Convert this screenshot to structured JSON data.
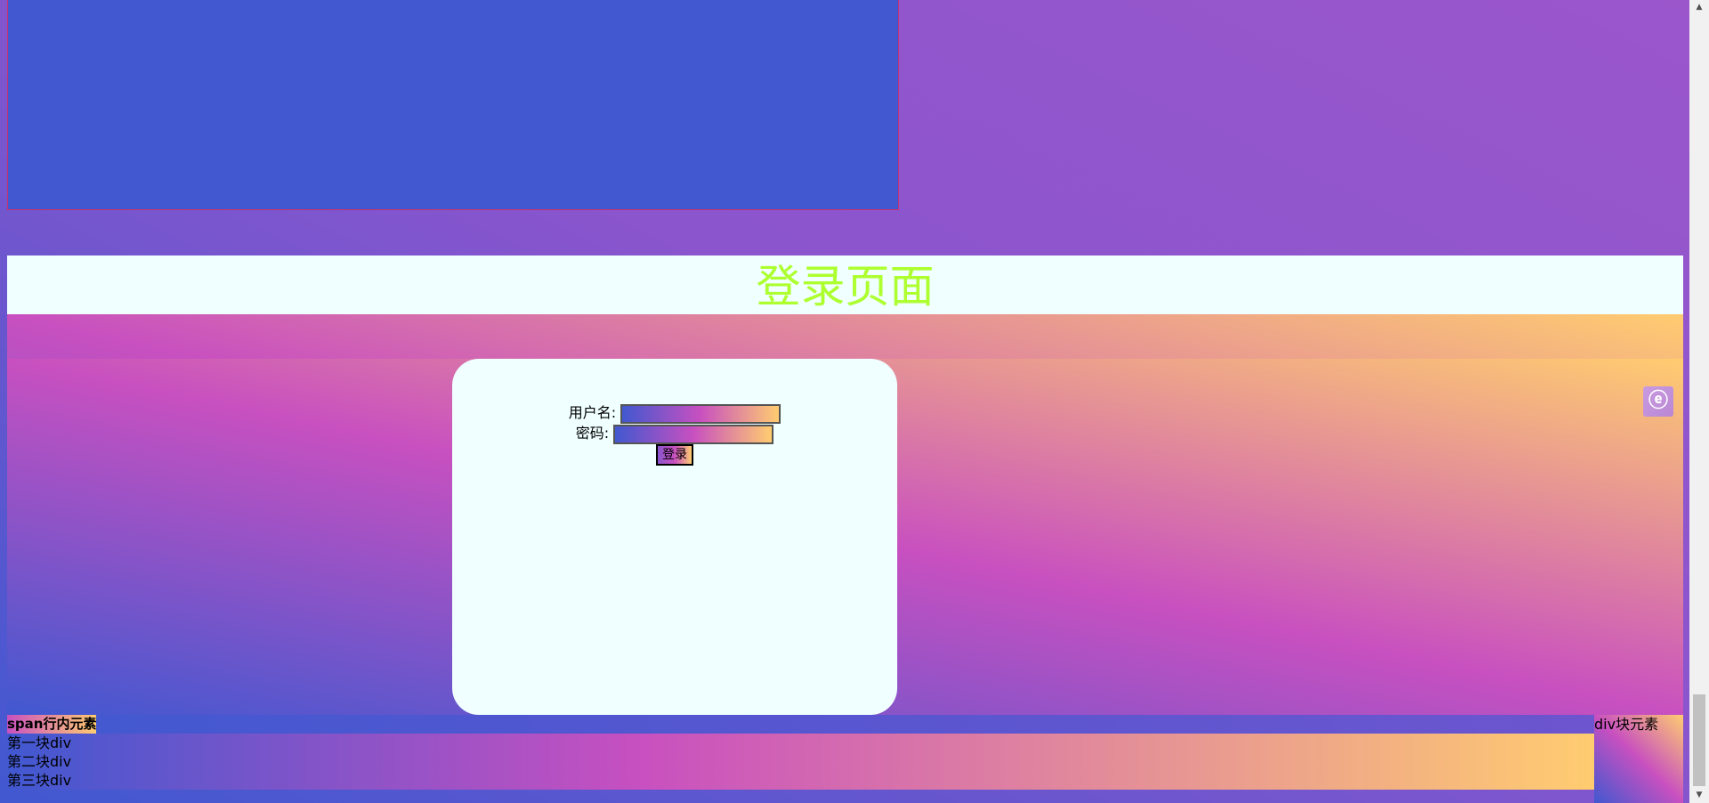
{
  "header": {
    "title": "登录页面"
  },
  "login": {
    "username_label": "用户名:",
    "password_label": "密码:",
    "username_placeholder": "",
    "password_placeholder": "",
    "submit_label": "登录"
  },
  "side_widget": {
    "icon": "e-icon",
    "glyph": "ⓔ"
  },
  "footer": {
    "span_text": "span行内元素",
    "div_block_text": "div块元素",
    "divs": [
      "第一块div",
      "第二块div",
      "第三块div"
    ]
  },
  "scrollbar": {
    "up_glyph": "▲",
    "down_glyph": "▼"
  },
  "colors": {
    "gradient_start": "#4158d0",
    "gradient_mid": "#c850c0",
    "gradient_end": "#ffcc70",
    "title_color": "#adff2f",
    "card_bg": "#f0ffff"
  }
}
